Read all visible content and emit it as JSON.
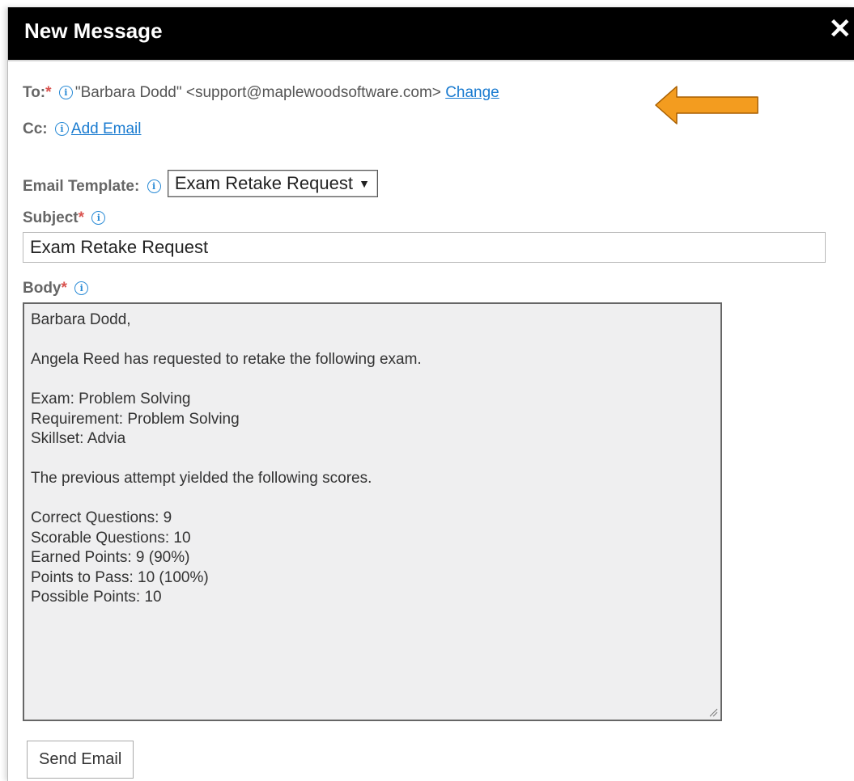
{
  "dialog": {
    "title": "New Message",
    "close_glyph": "✕"
  },
  "to": {
    "label": "To:",
    "required_mark": "*",
    "value": "\"Barbara Dodd\" <support@maplewoodsoftware.com>",
    "change_link": "Change"
  },
  "cc": {
    "label": "Cc:",
    "add_link": "Add Email"
  },
  "template": {
    "label": "Email Template:",
    "selected": "Exam Retake Request"
  },
  "subject": {
    "label": "Subject",
    "required_mark": "*",
    "value": "Exam Retake Request"
  },
  "body": {
    "label": "Body",
    "required_mark": "*",
    "lines": [
      "Barbara Dodd,",
      "",
      "Angela Reed has requested to retake the following exam.",
      "",
      "Exam: Problem Solving",
      "Requirement: Problem Solving",
      "Skillset: Advia",
      "",
      "The previous attempt yielded the following scores.",
      "",
      "Correct Questions: 9",
      "Scorable Questions: 10",
      "Earned Points: 9 (90%)",
      "Points to Pass: 10 (100%)",
      "Possible Points: 10"
    ]
  },
  "send_button": "Send Email",
  "colors": {
    "titlebar": "#000000",
    "link": "#1a7bd0",
    "required": "#d9534f",
    "info_icon": "#2a8bd6",
    "annotation_arrow": "#f39c1f"
  },
  "icons": {
    "info": "info-icon",
    "close": "close-icon",
    "dropdown": "chevron-down-icon",
    "annotation": "arrow-left-icon"
  }
}
